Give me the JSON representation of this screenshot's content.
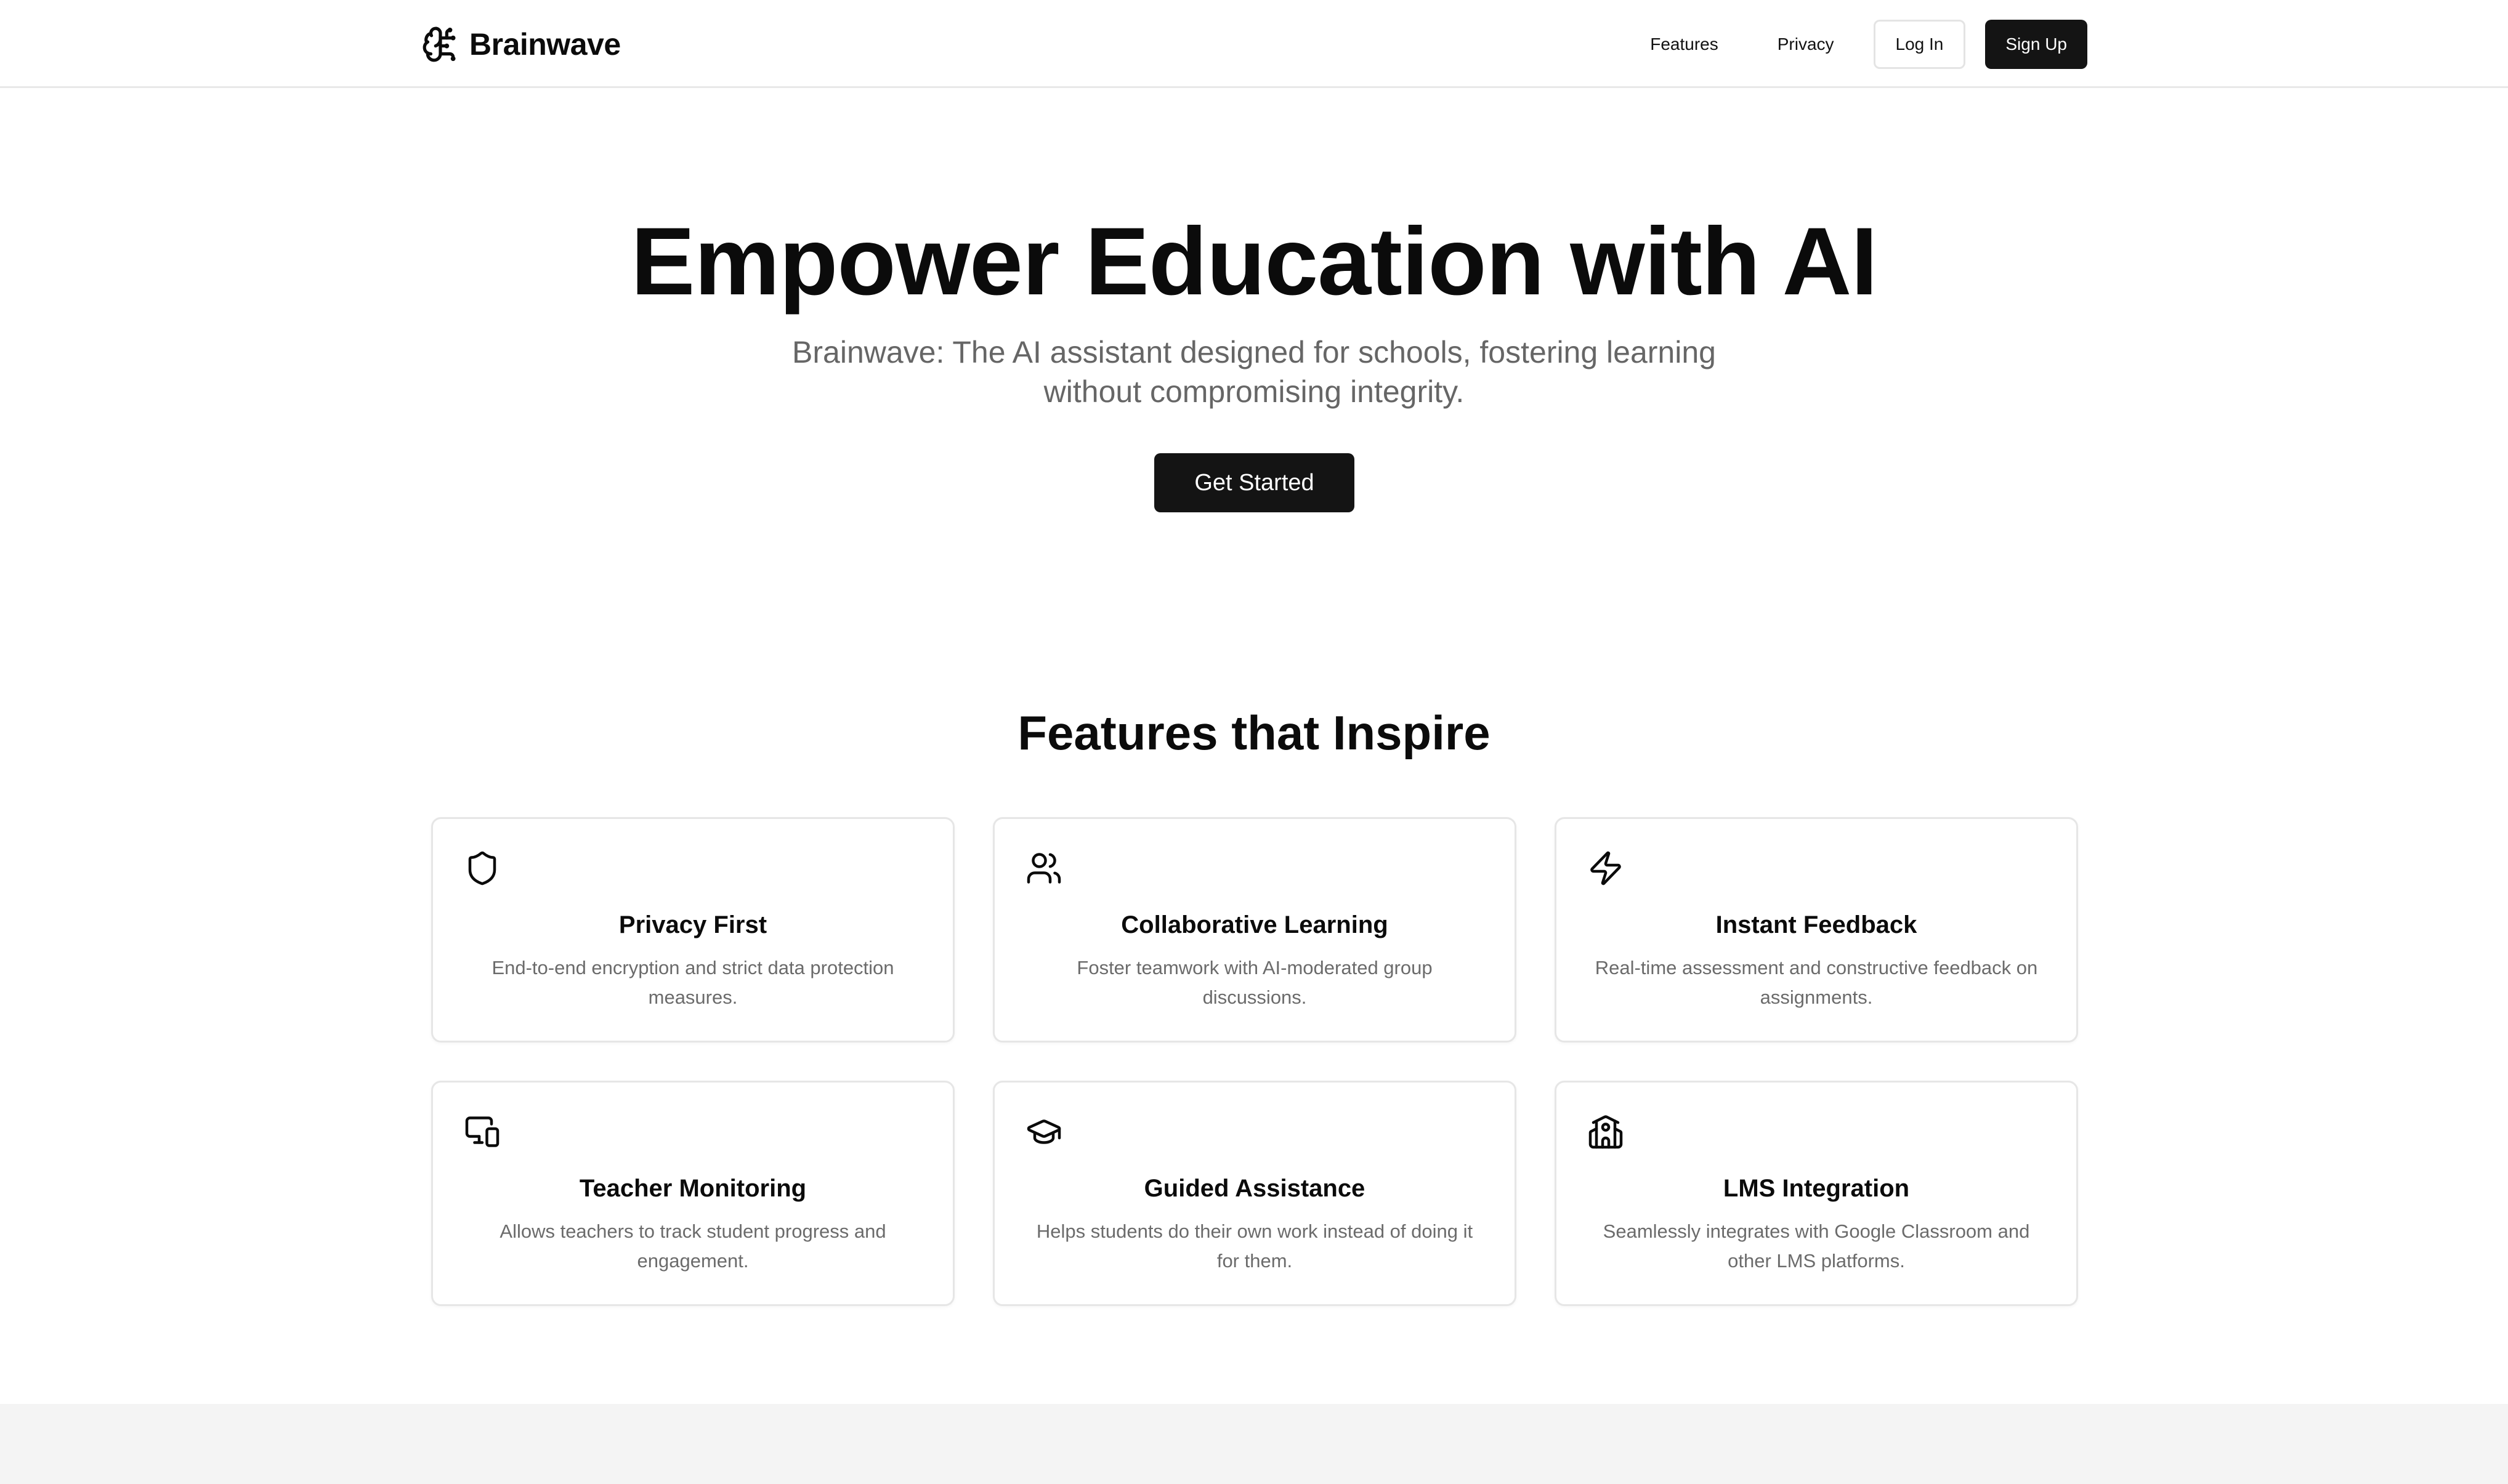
{
  "brand": {
    "icon": "brain-icon",
    "name": "Brainwave"
  },
  "nav": {
    "features": "Features",
    "privacy": "Privacy",
    "login": "Log In",
    "signup": "Sign Up"
  },
  "hero": {
    "title": "Empower Education with AI",
    "subtitle": "Brainwave: The AI assistant designed for schools, fostering learning without compromising integrity.",
    "cta": "Get Started"
  },
  "features": {
    "heading": "Features that Inspire",
    "items": [
      {
        "icon": "shield-icon",
        "title": "Privacy First",
        "description": "End-to-end encryption and strict data protection measures."
      },
      {
        "icon": "users-icon",
        "title": "Collaborative Learning",
        "description": "Foster teamwork with AI-moderated group discussions."
      },
      {
        "icon": "lightning-icon",
        "title": "Instant Feedback",
        "description": "Real-time assessment and constructive feedback on assignments."
      },
      {
        "icon": "monitor-devices-icon",
        "title": "Teacher Monitoring",
        "description": "Allows teachers to track student progress and engagement."
      },
      {
        "icon": "graduation-cap-icon",
        "title": "Guided Assistance",
        "description": "Helps students do their own work instead of doing it for them."
      },
      {
        "icon": "school-building-icon",
        "title": "LMS Integration",
        "description": "Seamlessly integrates with Google Classroom and other LMS platforms."
      }
    ]
  },
  "colors": {
    "primary_dark": "#141414",
    "text_muted": "#666666",
    "border": "#e6e6e6",
    "footer_bg": "#f4f4f4"
  }
}
